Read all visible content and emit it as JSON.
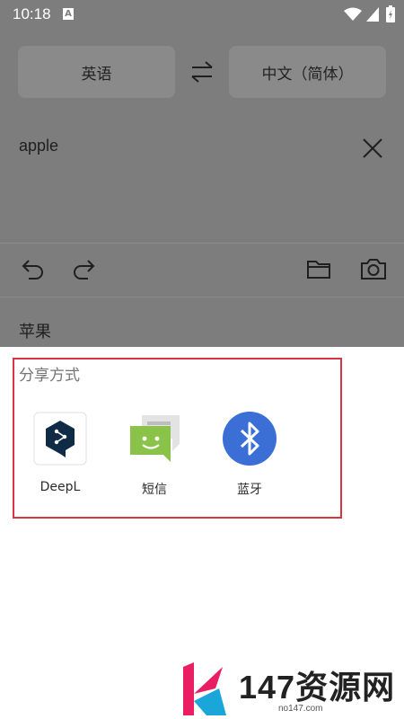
{
  "status_bar": {
    "time": "10:18",
    "notification_badge": "A"
  },
  "translator": {
    "source_language": "英语",
    "target_language": "中文（简体）",
    "input_text": "apple",
    "result_text": "苹果"
  },
  "share_sheet": {
    "title": "分享方式",
    "items": [
      {
        "label": "DeepL",
        "icon": "deepl-icon",
        "color": "#0f2b46"
      },
      {
        "label": "短信",
        "icon": "messaging-icon",
        "color": "#8bc34a"
      },
      {
        "label": "蓝牙",
        "icon": "bluetooth-icon",
        "color": "#3b6fd6"
      }
    ]
  },
  "watermark": {
    "text": "147资源网",
    "url": "no147.com"
  },
  "colors": {
    "highlight_border": "#d9343f",
    "dim_overlay": "#7d7d7d"
  }
}
